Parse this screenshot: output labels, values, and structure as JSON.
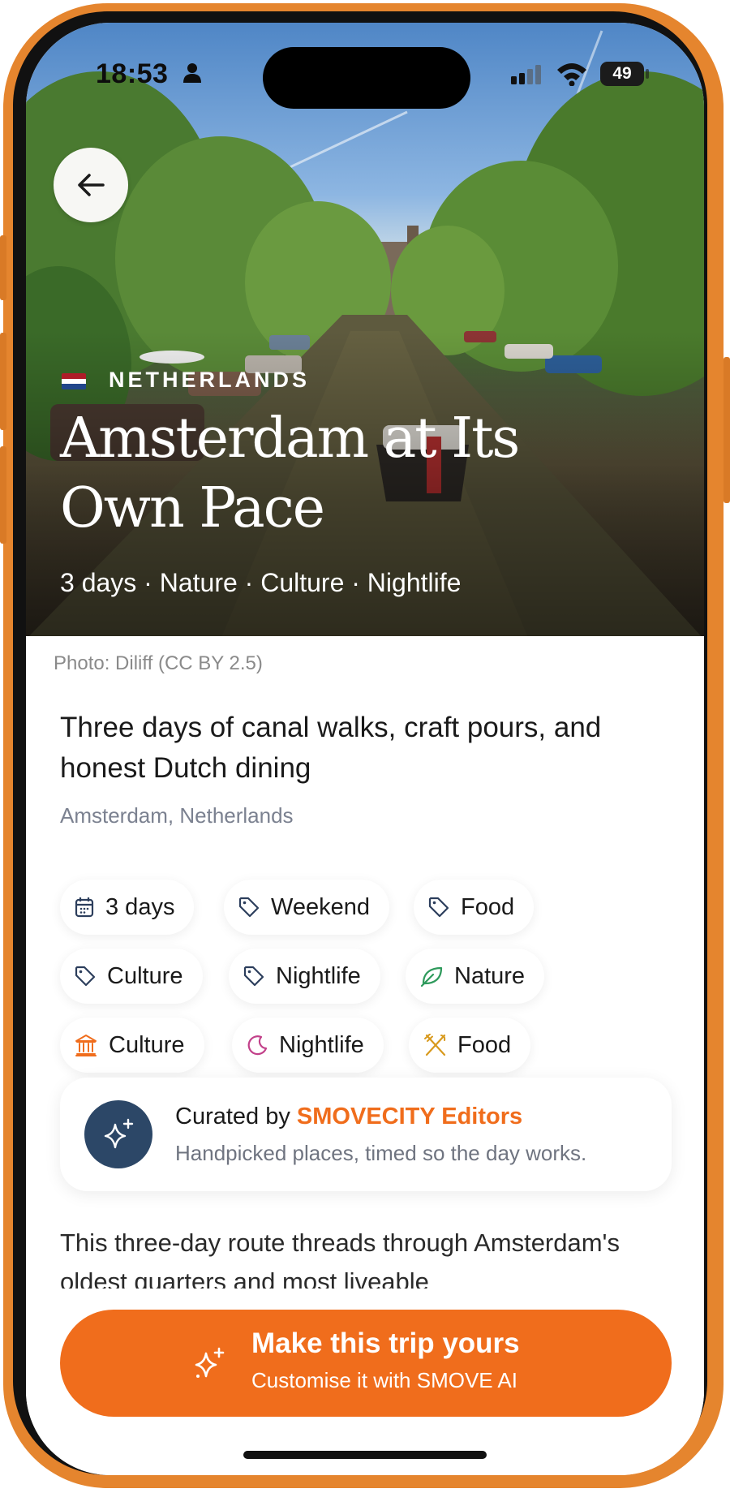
{
  "status_bar": {
    "time": "18:53",
    "battery": "49"
  },
  "hero": {
    "country": "NETHERLANDS",
    "title": "Amsterdam at Its Own Pace",
    "meta": "3 days · Nature · Culture · Nightlife",
    "flag_colors": [
      "#ae1c28",
      "#ffffff",
      "#21468b"
    ]
  },
  "photo_credit": "Photo: Diliff (CC BY 2.5)",
  "subtitle": "Three days of canal walks, craft pours, and honest Dutch dining",
  "location": "Amsterdam, Netherlands",
  "chips": [
    {
      "label": "3 days",
      "icon": "calendar-icon"
    },
    {
      "label": "Weekend",
      "icon": "tag-icon"
    },
    {
      "label": "Food",
      "icon": "tag-icon"
    },
    {
      "label": "Culture",
      "icon": "tag-icon"
    },
    {
      "label": "Nightlife",
      "icon": "tag-icon"
    },
    {
      "label": "Nature",
      "icon": "leaf-icon",
      "color": "#2f9a5c"
    },
    {
      "label": "Culture",
      "icon": "museum-icon",
      "color": "#f06d1c"
    },
    {
      "label": "Nightlife",
      "icon": "moon-icon",
      "color": "#c2418a"
    },
    {
      "label": "Food",
      "icon": "utensils-icon",
      "color": "#d89a1e"
    }
  ],
  "curated": {
    "prefix": "Curated by",
    "brand": "SMOVECITY Editors",
    "subtitle": "Handpicked places, timed so the day works.",
    "icon": "sparkles-icon"
  },
  "description": "This three-day route threads through Amsterdam's oldest quarters and most liveable",
  "cta": {
    "title": "Make this trip yours",
    "subtitle": "Customise it with SMOVE AI",
    "icon": "sparkles-icon",
    "color": "#f06d1c"
  }
}
